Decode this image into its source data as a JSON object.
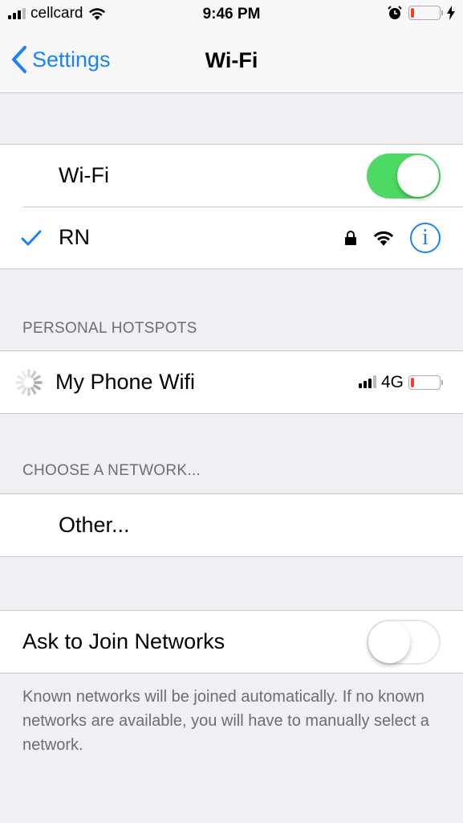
{
  "status_bar": {
    "carrier": "cellcard",
    "time": "9:46 PM",
    "signal_bars": 3,
    "signal_max": 4,
    "battery_level": 0.1,
    "charging": true
  },
  "nav": {
    "back_label": "Settings",
    "title": "Wi-Fi"
  },
  "wifi": {
    "label": "Wi-Fi",
    "enabled": true
  },
  "connected_network": {
    "name": "RN",
    "secured": true
  },
  "personal_hotspots": {
    "header": "PERSONAL HOTSPOTS",
    "items": [
      {
        "name": "My Phone Wifi",
        "network_type": "4G",
        "signal_bars": 3,
        "battery_level": 0.1
      }
    ]
  },
  "choose_network": {
    "header": "CHOOSE A NETWORK...",
    "other_label": "Other..."
  },
  "ask_to_join": {
    "label": "Ask to Join Networks",
    "enabled": false,
    "footer": "Known networks will be joined automatically. If no known networks are available, you will have to manually select a network."
  },
  "colors": {
    "accent": "#1a82fb",
    "switch_on": "#4cd964",
    "battery_low": "#ff3b30"
  }
}
